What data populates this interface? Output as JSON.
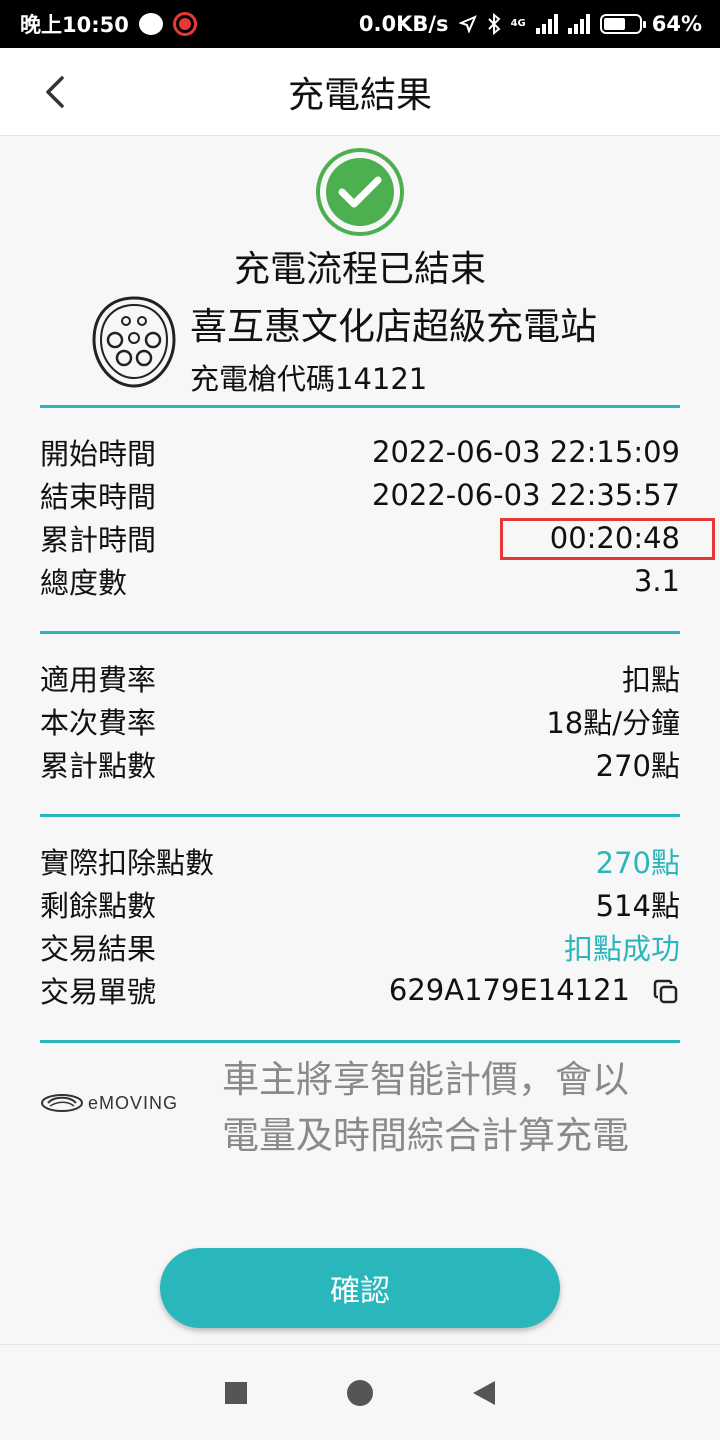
{
  "status_bar": {
    "time": "晚上10:50",
    "net_speed": "0.0KB/s",
    "net_type": "4G",
    "battery_pct": "64%",
    "battery_level": 0.64
  },
  "header": {
    "title": "充電結果",
    "back_icon": "chevron-left-icon"
  },
  "result": {
    "status_icon": "check-circle-icon",
    "status_color": "#4caf50",
    "title": "充電流程已結束",
    "station_name": "喜互惠文化店超級充電站",
    "gun_code": "充電槍代碼14121"
  },
  "session": [
    {
      "label": "開始時間",
      "value": "2022-06-03 22:15:09"
    },
    {
      "label": "結束時間",
      "value": "2022-06-03 22:35:57"
    },
    {
      "label": "累計時間",
      "value": "00:20:48"
    },
    {
      "label": "總度數",
      "value": "3.1"
    }
  ],
  "rate": [
    {
      "label": "適用費率",
      "value": "扣點"
    },
    {
      "label": "本次費率",
      "value": "18點/分鐘"
    },
    {
      "label": "累計點數",
      "value": "270點"
    }
  ],
  "transaction": [
    {
      "label": "實際扣除點數",
      "value": "270點"
    },
    {
      "label": "剩餘點數",
      "value": "514點"
    },
    {
      "label": "交易結果",
      "value": "扣點成功"
    },
    {
      "label": "交易單號",
      "value": "629A179E14121"
    }
  ],
  "brand": {
    "logo_text": "eMOVING"
  },
  "notice": "車主將享智能計價，會以電量及時間綜合計算充電",
  "confirm_button": "確認",
  "colors": {
    "accent": "#2ab7bb",
    "highlight": "#e53935"
  }
}
